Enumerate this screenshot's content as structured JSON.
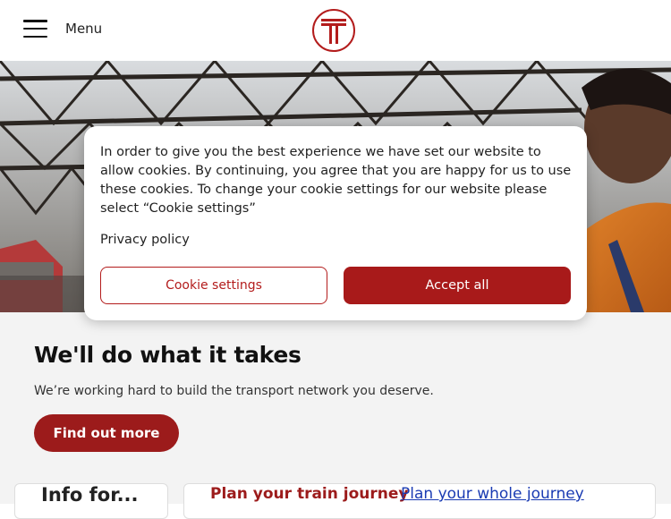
{
  "header": {
    "menu_label": "Menu"
  },
  "hero": {
    "image_description_icon": "station-photo"
  },
  "main": {
    "headline": "We'll do what it takes",
    "subtext": "We’re working hard to build the transport network you deserve.",
    "cta_label": "Find out more"
  },
  "cards": {
    "info_label": "Info for...",
    "plan_train_label": "Plan your train journey",
    "plan_whole_label": "Plan your whole journey"
  },
  "cookie_modal": {
    "message": "In order to give you the best experience we have set our website to allow cookies. By continuing, you agree that you are happy for us to use these cookies. To change your cookie settings for our website please select “Cookie settings”",
    "privacy_link": "Privacy policy",
    "settings_button": "Cookie settings",
    "accept_button": "Accept all"
  },
  "colors": {
    "brand_red": "#a81a1a",
    "link_blue": "#1a3bb3"
  }
}
